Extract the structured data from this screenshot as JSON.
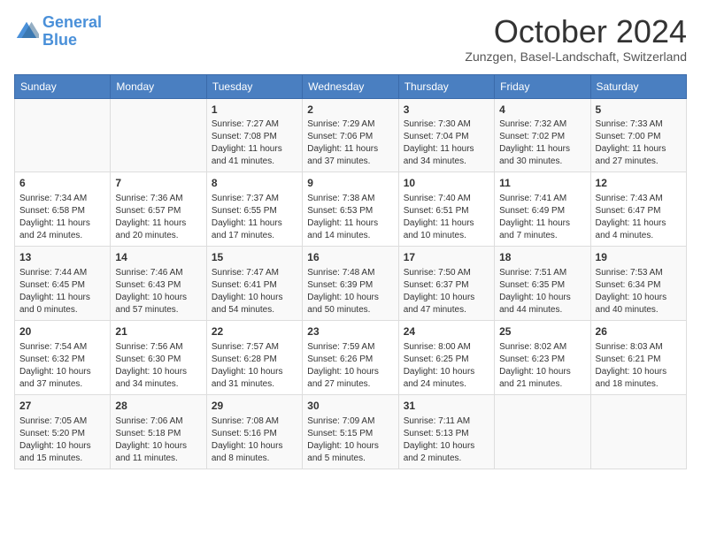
{
  "header": {
    "logo_line1": "General",
    "logo_line2": "Blue",
    "month": "October 2024",
    "location": "Zunzgen, Basel-Landschaft, Switzerland"
  },
  "days_of_week": [
    "Sunday",
    "Monday",
    "Tuesday",
    "Wednesday",
    "Thursday",
    "Friday",
    "Saturday"
  ],
  "weeks": [
    [
      {
        "day": "",
        "content": ""
      },
      {
        "day": "",
        "content": ""
      },
      {
        "day": "1",
        "content": "Sunrise: 7:27 AM\nSunset: 7:08 PM\nDaylight: 11 hours and 41 minutes."
      },
      {
        "day": "2",
        "content": "Sunrise: 7:29 AM\nSunset: 7:06 PM\nDaylight: 11 hours and 37 minutes."
      },
      {
        "day": "3",
        "content": "Sunrise: 7:30 AM\nSunset: 7:04 PM\nDaylight: 11 hours and 34 minutes."
      },
      {
        "day": "4",
        "content": "Sunrise: 7:32 AM\nSunset: 7:02 PM\nDaylight: 11 hours and 30 minutes."
      },
      {
        "day": "5",
        "content": "Sunrise: 7:33 AM\nSunset: 7:00 PM\nDaylight: 11 hours and 27 minutes."
      }
    ],
    [
      {
        "day": "6",
        "content": "Sunrise: 7:34 AM\nSunset: 6:58 PM\nDaylight: 11 hours and 24 minutes."
      },
      {
        "day": "7",
        "content": "Sunrise: 7:36 AM\nSunset: 6:57 PM\nDaylight: 11 hours and 20 minutes."
      },
      {
        "day": "8",
        "content": "Sunrise: 7:37 AM\nSunset: 6:55 PM\nDaylight: 11 hours and 17 minutes."
      },
      {
        "day": "9",
        "content": "Sunrise: 7:38 AM\nSunset: 6:53 PM\nDaylight: 11 hours and 14 minutes."
      },
      {
        "day": "10",
        "content": "Sunrise: 7:40 AM\nSunset: 6:51 PM\nDaylight: 11 hours and 10 minutes."
      },
      {
        "day": "11",
        "content": "Sunrise: 7:41 AM\nSunset: 6:49 PM\nDaylight: 11 hours and 7 minutes."
      },
      {
        "day": "12",
        "content": "Sunrise: 7:43 AM\nSunset: 6:47 PM\nDaylight: 11 hours and 4 minutes."
      }
    ],
    [
      {
        "day": "13",
        "content": "Sunrise: 7:44 AM\nSunset: 6:45 PM\nDaylight: 11 hours and 0 minutes."
      },
      {
        "day": "14",
        "content": "Sunrise: 7:46 AM\nSunset: 6:43 PM\nDaylight: 10 hours and 57 minutes."
      },
      {
        "day": "15",
        "content": "Sunrise: 7:47 AM\nSunset: 6:41 PM\nDaylight: 10 hours and 54 minutes."
      },
      {
        "day": "16",
        "content": "Sunrise: 7:48 AM\nSunset: 6:39 PM\nDaylight: 10 hours and 50 minutes."
      },
      {
        "day": "17",
        "content": "Sunrise: 7:50 AM\nSunset: 6:37 PM\nDaylight: 10 hours and 47 minutes."
      },
      {
        "day": "18",
        "content": "Sunrise: 7:51 AM\nSunset: 6:35 PM\nDaylight: 10 hours and 44 minutes."
      },
      {
        "day": "19",
        "content": "Sunrise: 7:53 AM\nSunset: 6:34 PM\nDaylight: 10 hours and 40 minutes."
      }
    ],
    [
      {
        "day": "20",
        "content": "Sunrise: 7:54 AM\nSunset: 6:32 PM\nDaylight: 10 hours and 37 minutes."
      },
      {
        "day": "21",
        "content": "Sunrise: 7:56 AM\nSunset: 6:30 PM\nDaylight: 10 hours and 34 minutes."
      },
      {
        "day": "22",
        "content": "Sunrise: 7:57 AM\nSunset: 6:28 PM\nDaylight: 10 hours and 31 minutes."
      },
      {
        "day": "23",
        "content": "Sunrise: 7:59 AM\nSunset: 6:26 PM\nDaylight: 10 hours and 27 minutes."
      },
      {
        "day": "24",
        "content": "Sunrise: 8:00 AM\nSunset: 6:25 PM\nDaylight: 10 hours and 24 minutes."
      },
      {
        "day": "25",
        "content": "Sunrise: 8:02 AM\nSunset: 6:23 PM\nDaylight: 10 hours and 21 minutes."
      },
      {
        "day": "26",
        "content": "Sunrise: 8:03 AM\nSunset: 6:21 PM\nDaylight: 10 hours and 18 minutes."
      }
    ],
    [
      {
        "day": "27",
        "content": "Sunrise: 7:05 AM\nSunset: 5:20 PM\nDaylight: 10 hours and 15 minutes."
      },
      {
        "day": "28",
        "content": "Sunrise: 7:06 AM\nSunset: 5:18 PM\nDaylight: 10 hours and 11 minutes."
      },
      {
        "day": "29",
        "content": "Sunrise: 7:08 AM\nSunset: 5:16 PM\nDaylight: 10 hours and 8 minutes."
      },
      {
        "day": "30",
        "content": "Sunrise: 7:09 AM\nSunset: 5:15 PM\nDaylight: 10 hours and 5 minutes."
      },
      {
        "day": "31",
        "content": "Sunrise: 7:11 AM\nSunset: 5:13 PM\nDaylight: 10 hours and 2 minutes."
      },
      {
        "day": "",
        "content": ""
      },
      {
        "day": "",
        "content": ""
      }
    ]
  ]
}
